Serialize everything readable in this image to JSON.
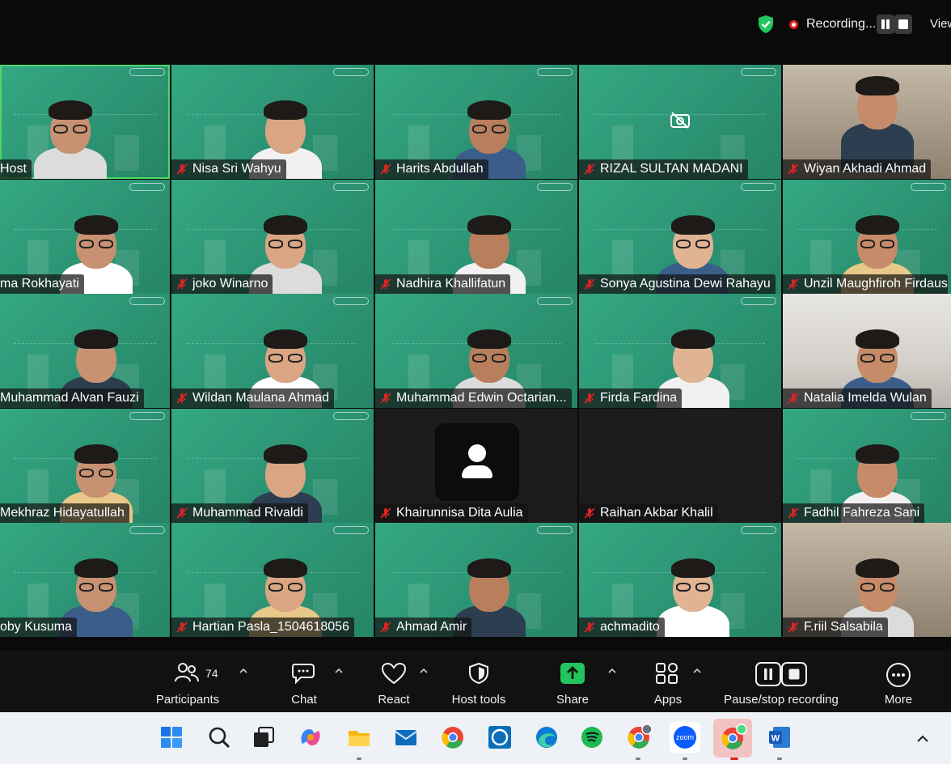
{
  "top_bar": {
    "recording_label": "Recording...",
    "view_label": "View",
    "colors": {
      "shield": "#22c55e",
      "recording": "#e02424"
    }
  },
  "gallery": {
    "tiles": [
      {
        "name": "Host",
        "muted": false,
        "video": "green",
        "active": true
      },
      {
        "name": "Nisa Sri Wahyu",
        "muted": true,
        "video": "green"
      },
      {
        "name": "Harits Abdullah",
        "muted": true,
        "video": "green"
      },
      {
        "name": "RIZAL SULTAN MADANI",
        "muted": true,
        "video": "green",
        "camera_off_icon": true
      },
      {
        "name": "Wiyan Akhadi Ahmad",
        "muted": true,
        "video": "photo-home"
      },
      {
        "name": "ma Rokhayati",
        "muted": false,
        "video": "green"
      },
      {
        "name": "joko Winarno",
        "muted": true,
        "video": "green"
      },
      {
        "name": "Nadhira Khallifatun",
        "muted": true,
        "video": "green"
      },
      {
        "name": "Sonya Agustina Dewi Rahayu",
        "muted": true,
        "video": "green"
      },
      {
        "name": "Unzil Maughfiroh Firdaus",
        "muted": true,
        "video": "green"
      },
      {
        "name": "Muhammad Alvan Fauzi",
        "muted": false,
        "video": "green"
      },
      {
        "name": "Wildan Maulana Ahmad",
        "muted": true,
        "video": "green"
      },
      {
        "name": "Muhammad Edwin Octarian...",
        "muted": true,
        "video": "green"
      },
      {
        "name": "Firda Fardina",
        "muted": true,
        "video": "green"
      },
      {
        "name": "Natalia Imelda Wulan",
        "muted": true,
        "video": "photo-room"
      },
      {
        "name": "Mekhraz Hidayatullah",
        "muted": false,
        "video": "green"
      },
      {
        "name": "Muhammad Rivaldi",
        "muted": true,
        "video": "green"
      },
      {
        "name": "Khairunnisa Dita Aulia",
        "muted": true,
        "video": "off"
      },
      {
        "name": "Raihan Akbar Khalil",
        "muted": true,
        "video": "off"
      },
      {
        "name": "Fadhil Fahreza Sani",
        "muted": true,
        "video": "green"
      },
      {
        "name": "oby Kusuma",
        "muted": false,
        "video": "green"
      },
      {
        "name": "Hartian Pasla_1504618056",
        "muted": true,
        "video": "green"
      },
      {
        "name": "Ahmad Amir",
        "muted": true,
        "video": "green"
      },
      {
        "name": "achmadito",
        "muted": true,
        "video": "green"
      },
      {
        "name": "F.riil Salsabila",
        "muted": true,
        "video": "photo-home"
      }
    ],
    "colors": {
      "active_border": "#4cd964",
      "mute_icon": "#e02424",
      "tile_green": "#2f9d7b"
    }
  },
  "toolbar": {
    "participants_label": "Participants",
    "participants_count": "74",
    "chat_label": "Chat",
    "react_label": "React",
    "host_tools_label": "Host tools",
    "share_label": "Share",
    "apps_label": "Apps",
    "recording_label": "Pause/stop recording",
    "more_label": "More",
    "colors": {
      "share": "#22c55e"
    }
  },
  "taskbar": {
    "icons": [
      "windows-start-icon",
      "search-icon",
      "task-view-icon",
      "copilot-icon",
      "file-explorer-icon",
      "mail-icon",
      "chrome-icon",
      "alexa-icon",
      "edge-icon",
      "spotify-icon",
      "chrome-profile-icon",
      "zoom-icon",
      "chrome-active-icon",
      "word-icon",
      "chevron-up-icon"
    ],
    "zoom_text": "zoom",
    "word_text": "W"
  }
}
